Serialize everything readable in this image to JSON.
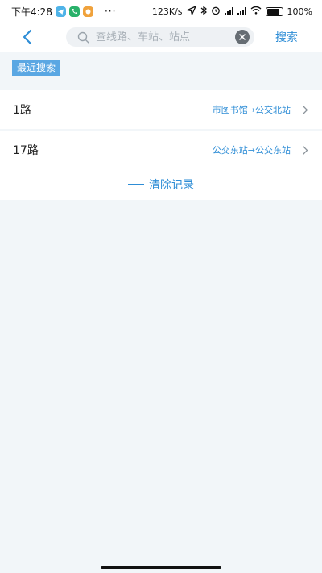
{
  "status_bar": {
    "time": "下午4:28",
    "dots": "···",
    "network_speed": "123K/s",
    "battery_percent": "100%",
    "app_badges": [
      {
        "icon": "telegram-icon",
        "color": "#4fb3e8"
      },
      {
        "icon": "phone-icon",
        "color": "#29b16a"
      },
      {
        "icon": "game-icon",
        "color": "#f0a23c"
      }
    ]
  },
  "header": {
    "search_placeholder": "查线路、车站、站点",
    "search_label": "搜索",
    "accent_color": "#2e8dd6"
  },
  "recent": {
    "tag_label": "最近搜索",
    "items": [
      {
        "route": "1路",
        "path": "市图书馆→公交北站"
      },
      {
        "route": "17路",
        "path": "公交东站→公交东站"
      }
    ],
    "clear_label": "清除记录"
  }
}
